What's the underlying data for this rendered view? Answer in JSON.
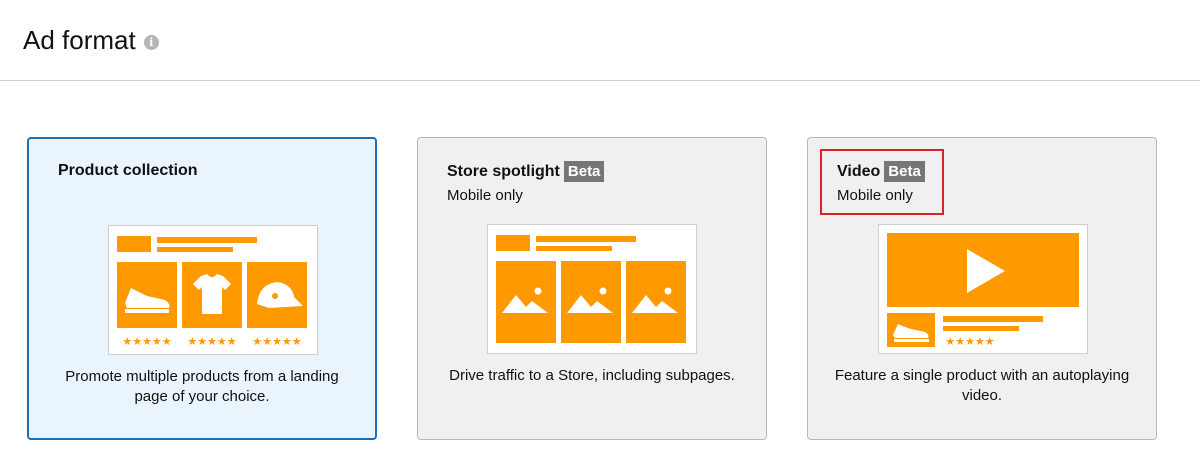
{
  "page": {
    "title": "Ad format",
    "info_icon": "info-icon",
    "info_glyph": "i"
  },
  "colors": {
    "accent": "#ff9900",
    "selected_border": "#1a6fb5",
    "selected_bg": "#eaf4fd",
    "badge_bg": "#767676",
    "highlight": "#d9242b"
  },
  "cards": [
    {
      "title": "Product collection",
      "subtitle": "",
      "badge": "",
      "selected": true,
      "description": "Promote multiple products from a landing page of your choice."
    },
    {
      "title": "Store spotlight",
      "badge": "Beta",
      "subtitle": "Mobile only",
      "selected": false,
      "description": "Drive traffic to a Store, including subpages."
    },
    {
      "title": "Video",
      "badge": "Beta",
      "subtitle": "Mobile only",
      "selected": false,
      "description": "Feature a single product with an autoplaying video."
    }
  ]
}
